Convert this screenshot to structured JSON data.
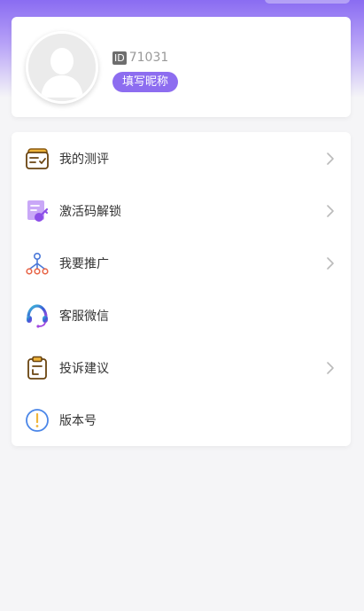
{
  "profile": {
    "id_tag": "ID",
    "id_value": "71031",
    "nickname_button": "填写昵称"
  },
  "menu": {
    "items": [
      {
        "label": "我的测评",
        "icon": "evaluation-card-icon",
        "has_arrow": true
      },
      {
        "label": "激活码解锁",
        "icon": "activation-key-icon",
        "has_arrow": true
      },
      {
        "label": "我要推广",
        "icon": "promotion-network-icon",
        "has_arrow": true
      },
      {
        "label": "客服微信",
        "icon": "headset-icon",
        "has_arrow": false
      },
      {
        "label": "投诉建议",
        "icon": "clipboard-icon",
        "has_arrow": true
      },
      {
        "label": "版本号",
        "icon": "info-circle-icon",
        "has_arrow": false
      }
    ]
  },
  "colors": {
    "accent": "#8d6df0",
    "header_gradient_top": "#8a6cf2",
    "background": "#f5f5f7"
  }
}
